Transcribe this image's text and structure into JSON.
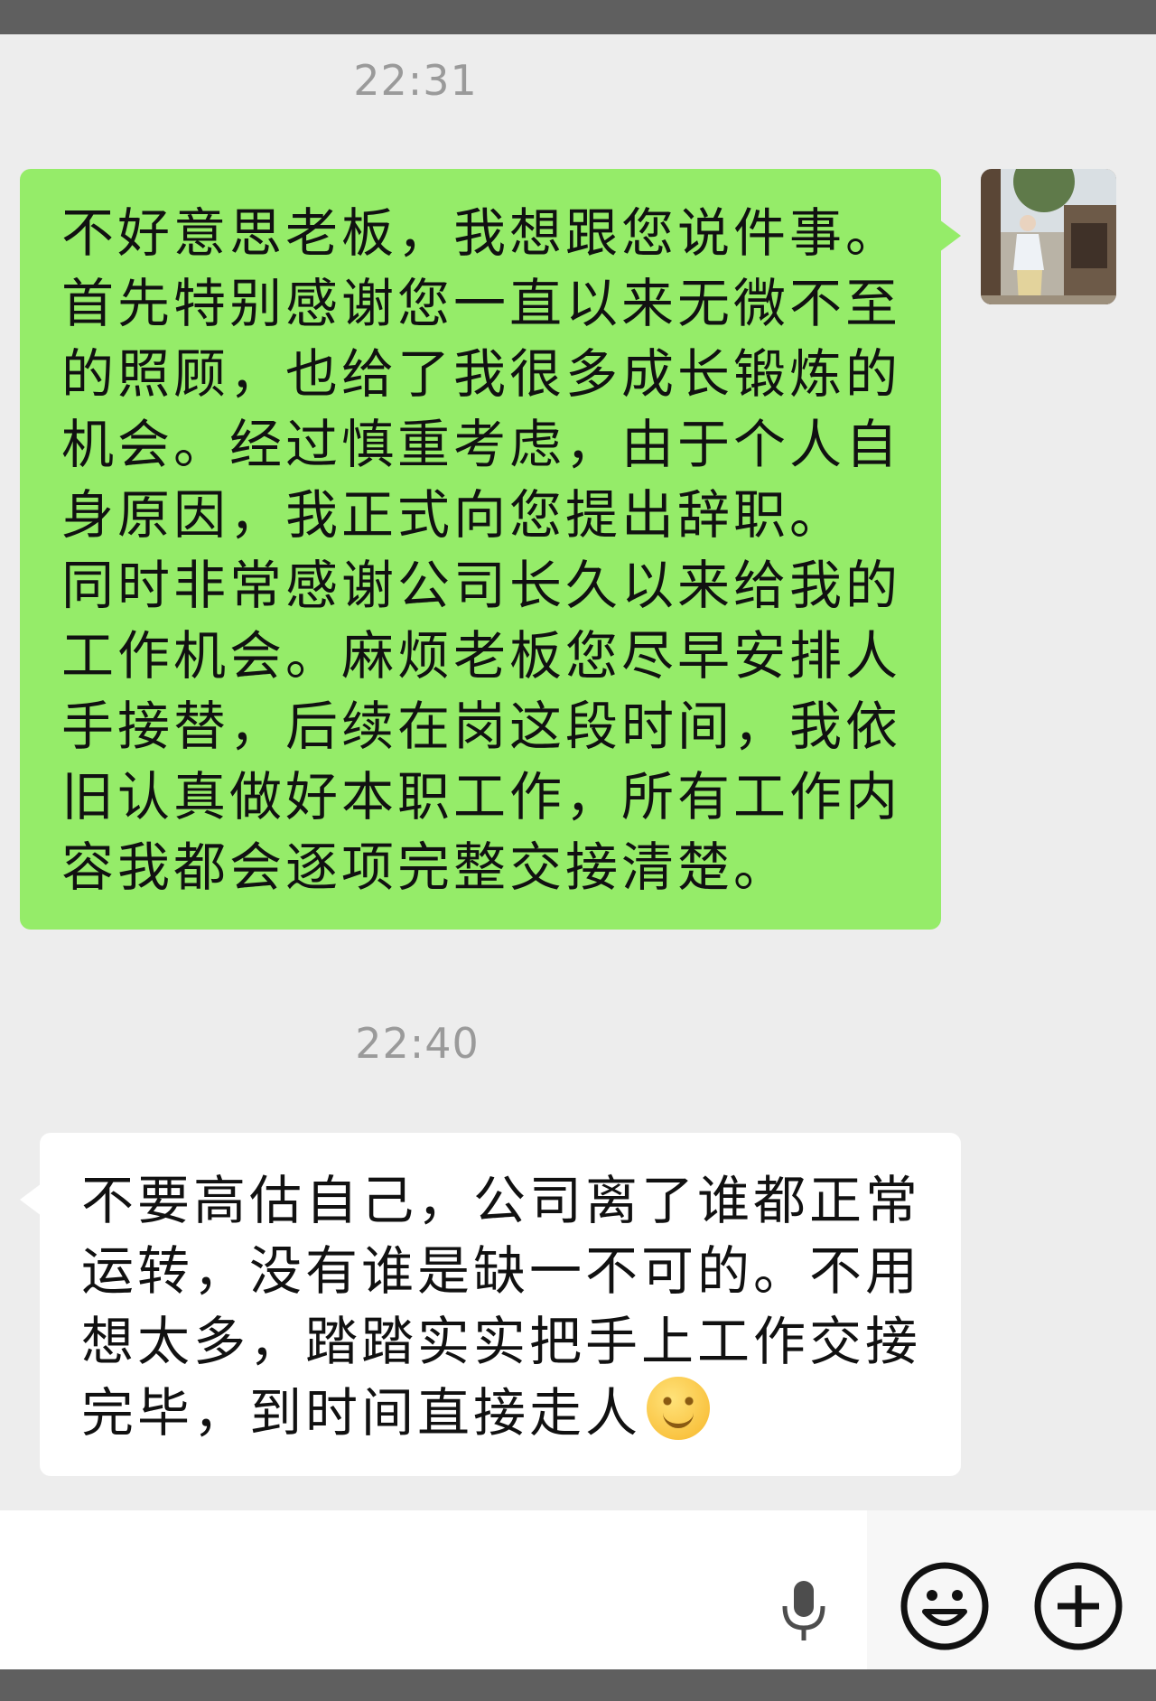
{
  "messages": [
    {
      "timestamp": "22:31",
      "sender": "me",
      "lines": [
        "不好意思老板，我想跟您说件事。",
        "首先特别感谢您一直以来无微不至",
        "的照顾，也给了我很多成长锻炼的",
        "机会。经过慎重考虑，由于个人自",
        "身原因，我正式向您提出辞职。",
        "同时非常感谢公司长久以来给我的",
        "工作机会。麻烦老板您尽早安排人",
        "手接替，后续在岗这段时间，我依",
        "旧认真做好本职工作，所有工作内",
        "容我都会逐项完整交接清楚。"
      ]
    },
    {
      "timestamp": "22:40",
      "sender": "boss",
      "lines": [
        "不要高估自己，公司离了谁都正常",
        "运转，没有谁是缺一不可的。不用",
        "想太多，踏踏实实把手上工作交接",
        "完毕，到时间直接走人"
      ],
      "trailing_icon": "smile-emoji"
    }
  ],
  "input_bar": {
    "icons": [
      "voice-icon",
      "emoji-icon",
      "plus-icon"
    ]
  },
  "colors": {
    "background": "#ededed",
    "sent_bubble": "#95ec69",
    "received_bubble": "#ffffff",
    "timestamp": "#9a9a9a"
  }
}
